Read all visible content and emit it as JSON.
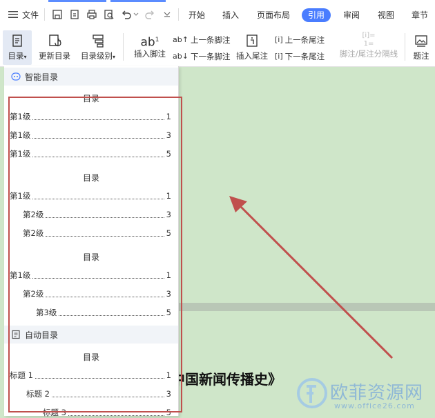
{
  "topbar": {
    "menu_label": "文件",
    "tabs": [
      {
        "label": "开始"
      },
      {
        "label": "插入"
      },
      {
        "label": "页面布局"
      },
      {
        "label": "引用"
      },
      {
        "label": "审阅"
      },
      {
        "label": "视图"
      },
      {
        "label": "章节"
      }
    ]
  },
  "ribbon": {
    "toc": "目录",
    "update_toc": "更新目录",
    "toc_level": "目录级别",
    "insert_footnote": "插入脚注",
    "prev_footnote": "上一条脚注",
    "next_footnote": "下一条脚注",
    "insert_endnote": "插入尾注",
    "prev_endnote": "上一条尾注",
    "next_endnote": "下一条尾注",
    "separator": "脚注/尾注分隔线",
    "caption": "题注",
    "ab_glyph": "ab"
  },
  "panel": {
    "smart_section": "智能目录",
    "auto_section": "自动目录",
    "toc_blocks": [
      {
        "title": "目录",
        "rows": [
          {
            "label": "第1级",
            "page": "1"
          },
          {
            "label": "第1级",
            "page": "3"
          },
          {
            "label": "第1级",
            "page": "5"
          }
        ]
      },
      {
        "title": "目录",
        "rows": [
          {
            "label": "第1级",
            "page": "1"
          },
          {
            "label": "第2级",
            "page": "3"
          },
          {
            "label": "第2级",
            "page": "5"
          }
        ]
      },
      {
        "title": "目录",
        "rows": [
          {
            "label": "第1级",
            "page": "1"
          },
          {
            "label": "第2级",
            "page": "3"
          },
          {
            "label": "第3级",
            "page": "5"
          }
        ]
      }
    ],
    "auto_block": {
      "title": "目录",
      "rows": [
        {
          "label": "标题 1",
          "page": "1"
        },
        {
          "label": "标题 2",
          "page": "3"
        },
        {
          "label": "标题 3",
          "page": "5"
        }
      ]
    }
  },
  "document": {
    "title_text": "中国新闻传播史》"
  },
  "watermark": {
    "text": "欧菲资源网",
    "url": "www.office26.com"
  },
  "colors": {
    "accent": "#4a7dff",
    "annotation": "#c0504d",
    "doc_bg": "#cfe6c9"
  }
}
